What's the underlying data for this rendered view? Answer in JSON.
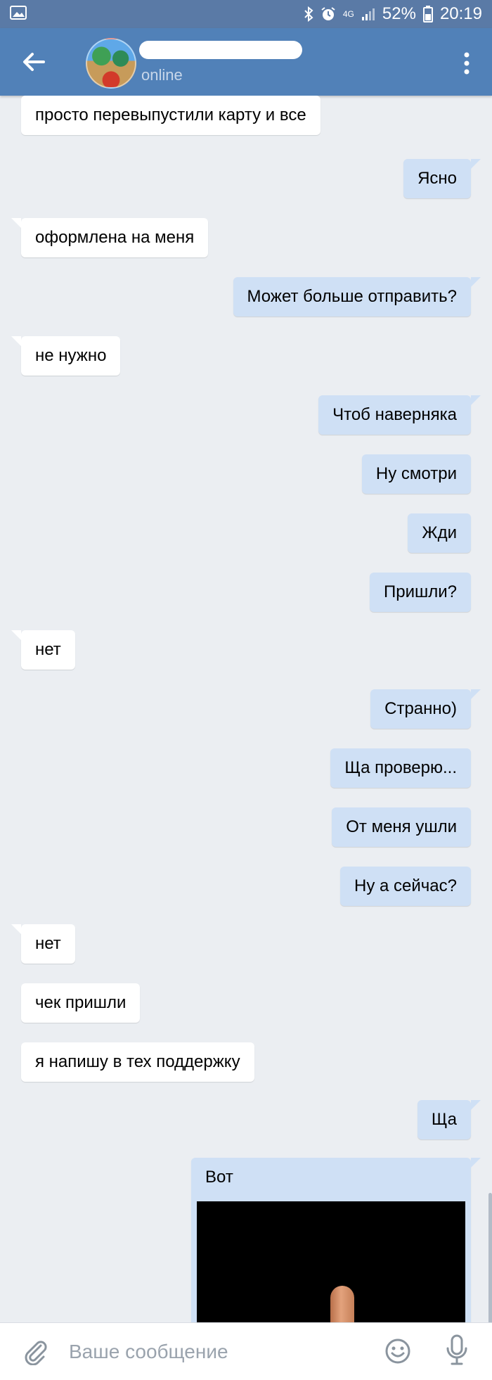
{
  "status_bar": {
    "battery_text": "52%",
    "time": "20:19",
    "network_label": "4G"
  },
  "header": {
    "presence": "online"
  },
  "messages": [
    {
      "dir": "in",
      "text": "просто перевыпустили карту и все"
    },
    {
      "dir": "out",
      "text": "Ясно"
    },
    {
      "dir": "in",
      "text": "оформлена на меня"
    },
    {
      "dir": "out",
      "text": "Может больше отправить?"
    },
    {
      "dir": "in",
      "text": "не нужно"
    },
    {
      "dir": "out",
      "text": "Чтоб наверняка"
    },
    {
      "dir": "out",
      "text": "Ну смотри"
    },
    {
      "dir": "out",
      "text": "Жди"
    },
    {
      "dir": "out",
      "text": "Пришли?"
    },
    {
      "dir": "in",
      "text": "нет"
    },
    {
      "dir": "out",
      "text": "Странно)"
    },
    {
      "dir": "out",
      "text": "Ща проверю..."
    },
    {
      "dir": "out",
      "text": "От меня ушли"
    },
    {
      "dir": "out",
      "text": "Ну а сейчас?"
    },
    {
      "dir": "in",
      "text": "нет"
    },
    {
      "dir": "in",
      "text": "чек пришли"
    },
    {
      "dir": "in",
      "text": "я напишу в тех поддержку"
    },
    {
      "dir": "out",
      "text": "Ща"
    }
  ],
  "photo_message": {
    "caption": "Вот"
  },
  "composer": {
    "placeholder": "Ваше сообщение"
  },
  "colors": {
    "header": "#5181b8",
    "status_bar": "#5a7aa6",
    "background": "#ebeef2",
    "outgoing_bubble": "#cfe0f5",
    "incoming_bubble": "#ffffff"
  },
  "icons": [
    "gallery-icon",
    "bluetooth-icon",
    "alarm-icon",
    "signal-icon",
    "battery-icon",
    "back-arrow-icon",
    "more-vert-icon",
    "attach-icon",
    "emoji-icon",
    "mic-icon"
  ]
}
